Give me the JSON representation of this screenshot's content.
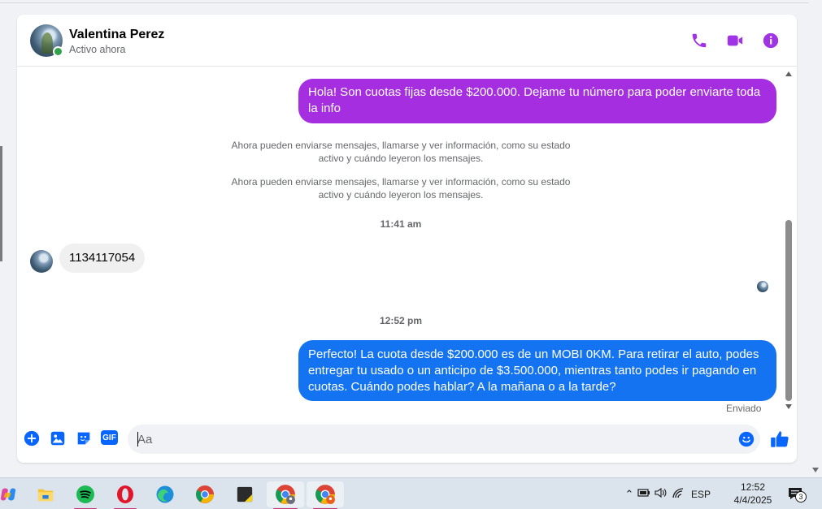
{
  "header": {
    "contact_name": "Valentina Perez",
    "status": "Activo ahora",
    "icons": [
      "phone-icon",
      "video-icon",
      "info-icon"
    ]
  },
  "messages": {
    "outgoing_1": "Hola! Son cuotas fijas desde $200.000. Dejame tu número para poder enviarte toda la info",
    "system_1": "Ahora pueden enviarse mensajes, llamarse y ver información, como su estado activo y cuándo leyeron los mensajes.",
    "system_2": "Ahora pueden enviarse mensajes, llamarse y ver información, como su estado activo y cuándo leyeron los mensajes.",
    "time_1": "11:41 am",
    "incoming_1": "1134117054",
    "time_2": "12:52 pm",
    "outgoing_2": "Perfecto! La cuota desde $200.000 es de un MOBI 0KM. Para retirar el auto, podes entregar tu usado o un anticipo de $3.500.000, mientras tanto podes ir pagando en cuotas. Cuándo podes hablar? A la mañana o a la tarde?",
    "sent_status": "Enviado"
  },
  "composer": {
    "placeholder": "Aa",
    "gif_label": "GIF"
  },
  "colors": {
    "purple_bubble": "#a52ee0",
    "blue_bubble": "#1473f0",
    "accent_purple": "#a033e6",
    "accent_blue": "#0866ff",
    "online": "#31a24c"
  },
  "taskbar": {
    "apps": [
      "copilot-icon",
      "file-explorer-icon",
      "spotify-icon",
      "opera-icon",
      "edge-icon",
      "chrome-icon",
      "sticky-notes-icon",
      "chrome-profile-1-icon",
      "chrome-profile-2-icon"
    ],
    "language": "ESP",
    "time": "12:52",
    "date": "4/4/2025",
    "notification_count": "3"
  }
}
